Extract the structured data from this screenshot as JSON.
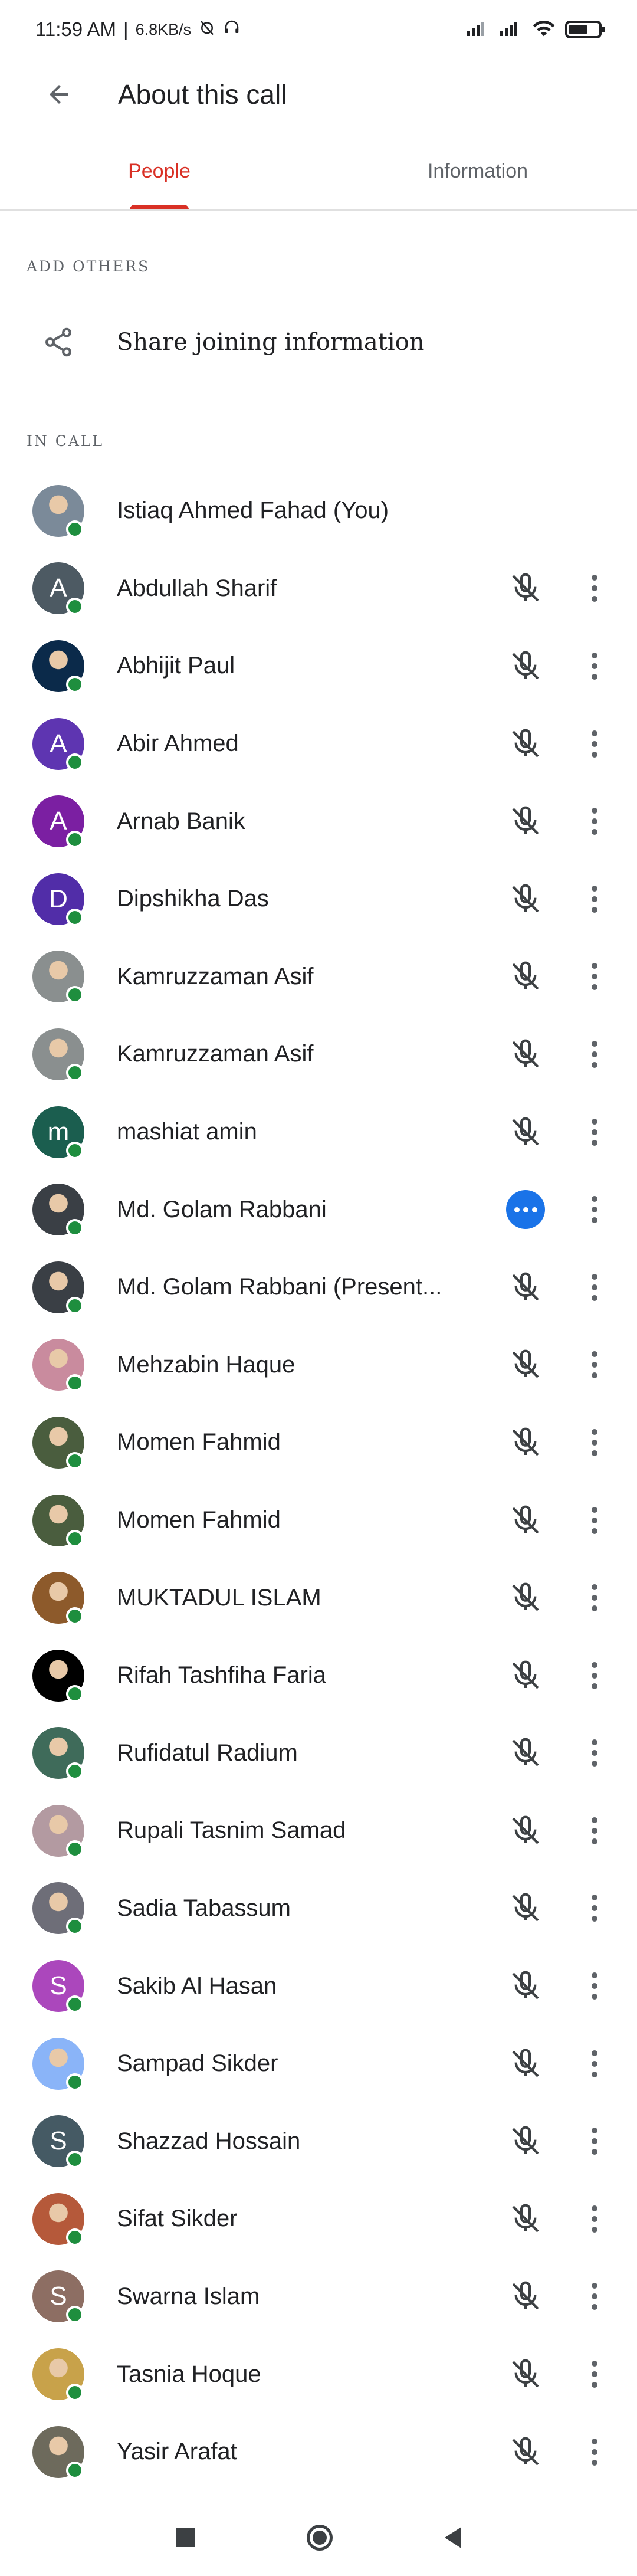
{
  "status": {
    "time": "11:59 AM",
    "separator": "|",
    "speed": "6.8KB/s"
  },
  "header": {
    "title": "About this call"
  },
  "tabs": [
    {
      "label": "People"
    },
    {
      "label": "Information"
    }
  ],
  "sections": {
    "add_others": "ADD OTHERS",
    "share_label": "Share joining information",
    "in_call": "IN CALL"
  },
  "colors": {
    "accent": "#d93025",
    "online": "#1e8e3e",
    "speaking": "#1a73e8"
  },
  "participants": [
    {
      "name": "Istiaq Ahmed Fahad (You)",
      "initial": "",
      "avatar_color": "#7b8a99",
      "photo": true,
      "self": true,
      "state": "none"
    },
    {
      "name": "Abdullah Sharif",
      "initial": "A",
      "avatar_color": "#4d5a63",
      "photo": false,
      "state": "muted"
    },
    {
      "name": "Abhijit Paul",
      "initial": "",
      "avatar_color": "#0b2a4a",
      "photo": true,
      "state": "muted"
    },
    {
      "name": "Abir Ahmed",
      "initial": "A",
      "avatar_color": "#5e35b1",
      "photo": false,
      "state": "muted"
    },
    {
      "name": "Arnab Banik",
      "initial": "A",
      "avatar_color": "#7b1fa2",
      "photo": false,
      "state": "muted"
    },
    {
      "name": "Dipshikha Das",
      "initial": "D",
      "avatar_color": "#512da8",
      "photo": false,
      "state": "muted"
    },
    {
      "name": "Kamruzzaman Asif",
      "initial": "",
      "avatar_color": "#8a8f8f",
      "photo": true,
      "state": "muted"
    },
    {
      "name": "Kamruzzaman Asif",
      "initial": "",
      "avatar_color": "#8a8f8f",
      "photo": true,
      "state": "muted"
    },
    {
      "name": "mashiat amin",
      "initial": "m",
      "avatar_color": "#1b5e4f",
      "photo": false,
      "state": "muted"
    },
    {
      "name": "Md. Golam Rabbani",
      "initial": "",
      "avatar_color": "#3a3f45",
      "photo": true,
      "state": "speaking"
    },
    {
      "name": "Md. Golam Rabbani (Present...",
      "initial": "",
      "avatar_color": "#3a3f45",
      "photo": true,
      "state": "muted"
    },
    {
      "name": "Mehzabin Haque",
      "initial": "",
      "avatar_color": "#c98b9e",
      "photo": true,
      "state": "muted"
    },
    {
      "name": "Momen Fahmid",
      "initial": "",
      "avatar_color": "#4a5d3e",
      "photo": true,
      "state": "muted"
    },
    {
      "name": "Momen Fahmid",
      "initial": "",
      "avatar_color": "#4a5d3e",
      "photo": true,
      "state": "muted"
    },
    {
      "name": "MUKTADUL ISLAM",
      "initial": "",
      "avatar_color": "#8d5a2b",
      "photo": true,
      "state": "muted"
    },
    {
      "name": "Rifah Tashfiha Faria",
      "initial": "",
      "avatar_color": "#000000",
      "photo": true,
      "state": "muted"
    },
    {
      "name": "Rufidatul Radium",
      "initial": "",
      "avatar_color": "#3f6b5a",
      "photo": true,
      "state": "muted"
    },
    {
      "name": "Rupali Tasnim Samad",
      "initial": "",
      "avatar_color": "#b39aa1",
      "photo": true,
      "state": "muted"
    },
    {
      "name": "Sadia Tabassum",
      "initial": "",
      "avatar_color": "#6e6e78",
      "photo": true,
      "state": "muted"
    },
    {
      "name": "Sakib Al Hasan",
      "initial": "S",
      "avatar_color": "#ab47bc",
      "photo": false,
      "state": "muted"
    },
    {
      "name": "Sampad Sikder",
      "initial": "",
      "avatar_color": "#8ab4f8",
      "photo": true,
      "state": "muted"
    },
    {
      "name": "Shazzad Hossain",
      "initial": "S",
      "avatar_color": "#455a64",
      "photo": false,
      "state": "muted"
    },
    {
      "name": "Sifat Sikder",
      "initial": "",
      "avatar_color": "#b5593a",
      "photo": true,
      "state": "muted"
    },
    {
      "name": "Swarna Islam",
      "initial": "S",
      "avatar_color": "#8d6e63",
      "photo": false,
      "state": "muted"
    },
    {
      "name": "Tasnia Hoque",
      "initial": "",
      "avatar_color": "#c8a24a",
      "photo": true,
      "state": "muted"
    },
    {
      "name": "Yasir Arafat",
      "initial": "",
      "avatar_color": "#6d6a5c",
      "photo": true,
      "state": "muted"
    }
  ]
}
